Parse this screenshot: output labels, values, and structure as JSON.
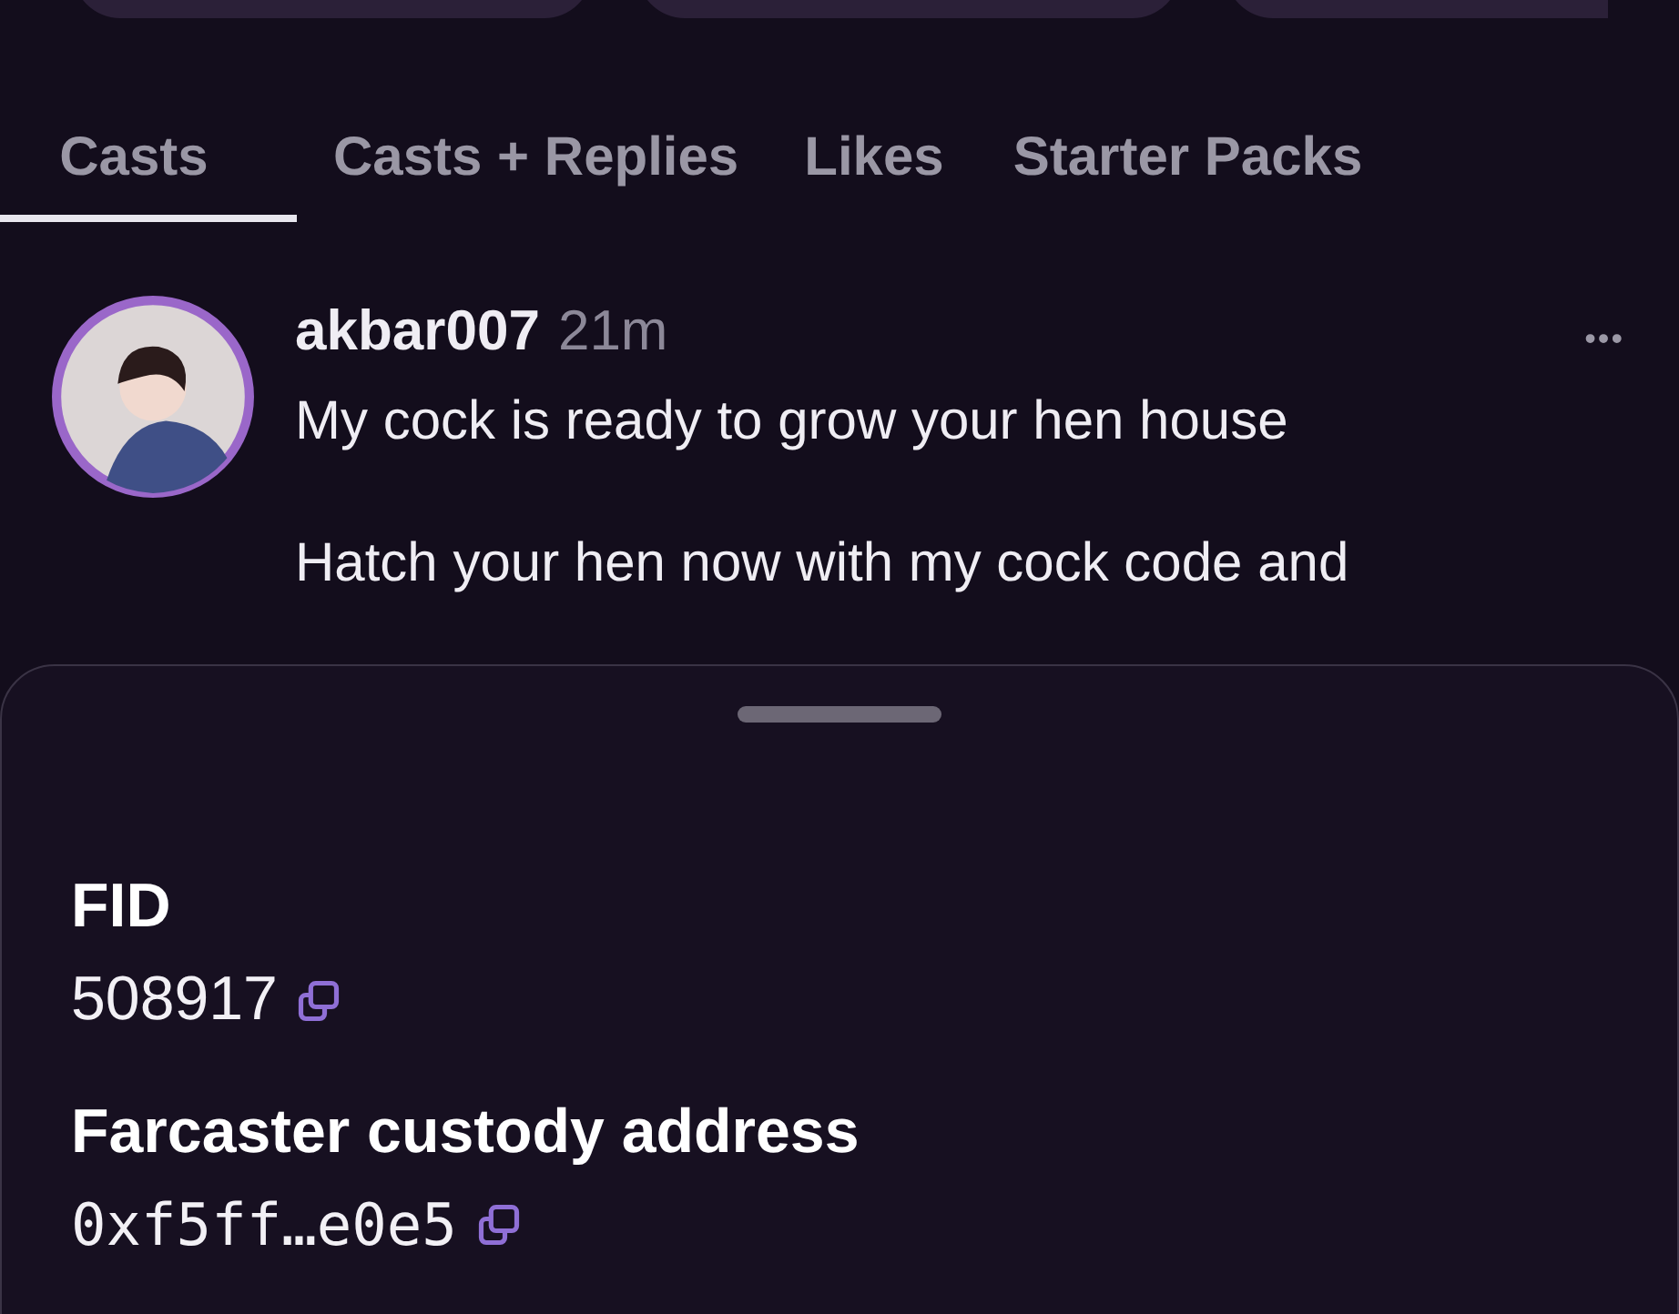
{
  "tabs": [
    {
      "label": "Casts",
      "selected": true
    },
    {
      "label": "Casts + Replies",
      "selected": false
    },
    {
      "label": "Likes",
      "selected": false
    },
    {
      "label": "Starter Packs",
      "selected": false
    }
  ],
  "cast": {
    "username": "akbar007",
    "time": "21m",
    "more": "•••",
    "paragraphs": [
      "My cock is ready to grow your hen house",
      "Hatch your hen now with my cock code and"
    ]
  },
  "sheet": {
    "fields": [
      {
        "label": "FID",
        "value": "508917",
        "kind": "number"
      },
      {
        "label": "Farcaster custody address",
        "value": "0xf5ff…e0e5",
        "kind": "address"
      }
    ]
  }
}
